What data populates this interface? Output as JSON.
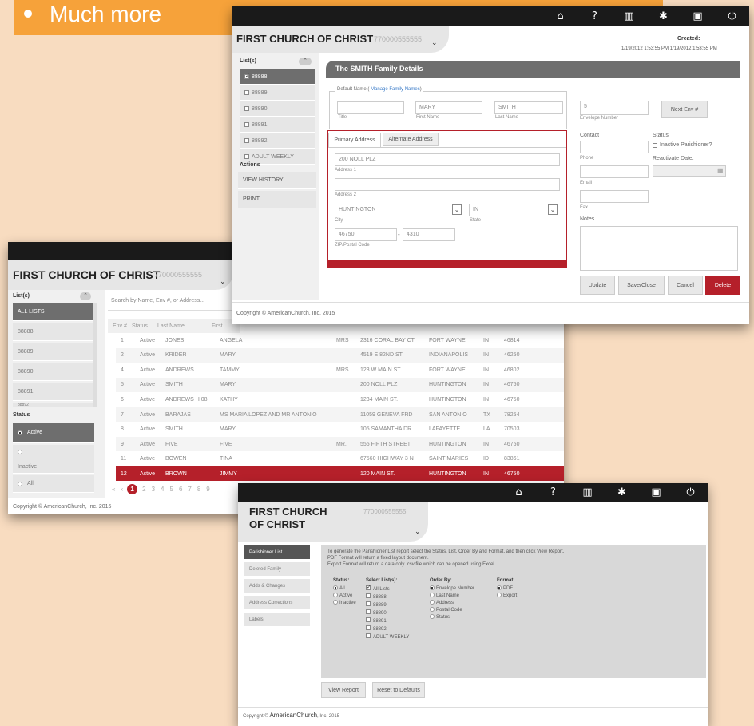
{
  "banner": {
    "text": "Much more"
  },
  "colors": {
    "accent": "#b5202a",
    "banner": "#f6a23a",
    "topbar": "#1a1a1a"
  },
  "topicons": [
    "home-icon",
    "help-icon",
    "chart-icon",
    "gear-icon",
    "briefcase-icon",
    "power-icon"
  ],
  "win1": {
    "org": "FIRST CHURCH OF CHRIST",
    "orgnum": "770000555555",
    "created_label": "Created:",
    "created_value": "1/19/2012 1:53:55 PM   1/19/2012 1:53:55 PM",
    "lists_title": "List(s)",
    "lists": [
      "88888",
      "88889",
      "88890",
      "88891",
      "88892",
      "ADULT WEEKLY"
    ],
    "actions_title": "Actions",
    "actions": [
      "VIEW HISTORY",
      "PRINT"
    ],
    "panel_title": "The SMITH Family Details",
    "default_name": "Default Name (",
    "manage_link": "Manage Family Names",
    "close_paren": ")",
    "title_label": "Title",
    "first_value": "MARY",
    "first_label": "First Name",
    "last_value": "SMITH",
    "last_label": "Last Name",
    "env_value": "5",
    "env_label": "Envelope Number",
    "next_env": "Next Env #",
    "tab_primary": "Primary Address",
    "tab_alternate": "Alternate Address",
    "addr1_value": "200 NOLL PLZ",
    "addr1_label": "Address 1",
    "addr2_label": "Address 2",
    "city_value": "HUNTINGTON",
    "city_label": "City",
    "state_value": "IN",
    "state_label": "State",
    "zip_value": "46750",
    "zip_dash": "-",
    "zip4_value": "4310",
    "zip_label": "ZIP/Postal Code",
    "contact_label": "Contact",
    "phone_label": "Phone",
    "email_label": "Email",
    "fax_label": "Fax",
    "notes_label": "Notes",
    "status_label": "Status",
    "inactive_label": "Inactive Parishioner?",
    "reactivate_label": "Reactivate Date:",
    "btn_update": "Update",
    "btn_saveclose": "Save/Close",
    "btn_cancel": "Cancel",
    "btn_delete": "Delete",
    "copyright": "Copyright © AmericanChurch, Inc. 2015"
  },
  "win2": {
    "org": "FIRST CHURCH OF CHRIST",
    "orgnum": "770000555555",
    "lists_title": "List(s)",
    "lists": [
      "ALL LISTS",
      "88888",
      "88889",
      "88890",
      "88891",
      "88892"
    ],
    "status_title": "Status",
    "statuses": [
      "Active",
      "Inactive",
      "All"
    ],
    "search_placeholder": "Search by Name, Env #, or Address...",
    "headers": [
      "Env #",
      "Status",
      "Last Name",
      "First"
    ],
    "rows": [
      [
        "1",
        "Active",
        "JONES",
        "ANGELA",
        "MRS",
        "2316 CORAL BAY CT",
        "FORT WAYNE",
        "IN",
        "46814"
      ],
      [
        "2",
        "Active",
        "KRIDER",
        "MARY",
        "",
        "4519 E 82ND ST",
        "INDIANAPOLIS",
        "IN",
        "46250"
      ],
      [
        "4",
        "Active",
        "ANDREWS",
        "TAMMY",
        "MRS",
        "123 W MAIN ST",
        "FORT WAYNE",
        "IN",
        "46802"
      ],
      [
        "5",
        "Active",
        "SMITH",
        "MARY",
        "",
        "200 NOLL PLZ",
        "HUNTINGTON",
        "IN",
        "46750"
      ],
      [
        "6",
        "Active",
        "ANDREWS H 08",
        "KATHY",
        "",
        "1234 MAIN ST.",
        "HUNTINGTON",
        "IN",
        "46750"
      ],
      [
        "7",
        "Active",
        "BARAJAS",
        "MS MARIA LOPEZ AND MR ANTONIO",
        "",
        "11059 GENEVA FRD",
        "SAN ANTONIO",
        "TX",
        "78254"
      ],
      [
        "8",
        "Active",
        "SMITH",
        "MARY",
        "",
        "105 SAMANTHA DR",
        "LAFAYETTE",
        "LA",
        "70503"
      ],
      [
        "9",
        "Active",
        "FIVE",
        "FIVE",
        "MR.",
        "555 FIFTH STREET",
        "HUNTINGTON",
        "IN",
        "46750"
      ],
      [
        "11",
        "Active",
        "BOWEN",
        "TINA",
        "",
        "67560 HIGHWAY 3 N",
        "SAINT MARIES",
        "ID",
        "83861"
      ],
      [
        "12",
        "Active",
        "BROWN",
        "JIMMY",
        "",
        "120 MAIN ST.",
        "HUNTINGTON",
        "IN",
        "46750"
      ]
    ],
    "pager_prev": "‹",
    "pager_first": "«",
    "pages": [
      "1",
      "2",
      "3",
      "4",
      "5",
      "6",
      "7",
      "8",
      "9"
    ],
    "copyright": "Copyright ©  AmericanChurch,  Inc. 2015"
  },
  "win3": {
    "org_line1": "FIRST CHURCH",
    "org_line2": "OF CHRIST",
    "orgnum": "770000555555",
    "nav": [
      "Parishioner List",
      "Deleted Family",
      "Adds & Changes",
      "Address Corrections",
      "Labels"
    ],
    "intro1": "To generate the Parishioner List report select the Status, List, Order By and Format, and then click View Report.",
    "intro2": "PDF Format will return a fixed layout document.",
    "intro3": "Export Format will return a data only .csv file which can be opened using Excel.",
    "status_title": "Status:",
    "status_opts": [
      "All",
      "Active",
      "Inactive"
    ],
    "lists_title": "Select List(s):",
    "list_opts": [
      "All Lists",
      "88888",
      "88889",
      "88890",
      "88891",
      "88892",
      "ADULT WEEKLY"
    ],
    "order_title": "Order By:",
    "order_opts": [
      "Envelope Number",
      "Last Name",
      "Address",
      "Postal Code",
      "Status"
    ],
    "format_title": "Format:",
    "format_opts": [
      "PDF",
      "Export"
    ],
    "btn_view": "View Report",
    "btn_reset": "Reset to Defaults",
    "copyright_pre": "Copyright © ",
    "copyright_brand": "AmericanChurch",
    "copyright_post": ", Inc. 2015"
  }
}
